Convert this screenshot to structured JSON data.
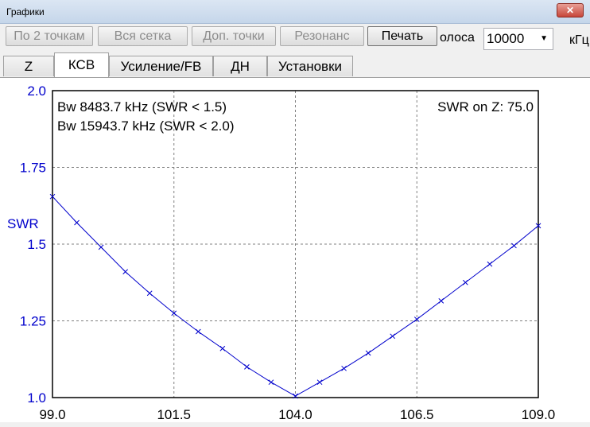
{
  "window": {
    "title": "Графики",
    "close_label": "✕"
  },
  "toolbar": {
    "buttons": [
      {
        "label": "По 2 точкам",
        "enabled": false
      },
      {
        "label": "Вся сетка",
        "enabled": false
      },
      {
        "label": "Доп. точки",
        "enabled": false
      },
      {
        "label": "Резонанс",
        "enabled": false
      },
      {
        "label": "Печать",
        "enabled": true
      }
    ],
    "band_label": "олоса",
    "band_value": "10000",
    "unit_label": "кГц"
  },
  "tabs": [
    {
      "label": "Z",
      "selected": false
    },
    {
      "label": "КСВ",
      "selected": true
    },
    {
      "label": "Усиление/FB",
      "selected": false
    },
    {
      "label": "ДН",
      "selected": false
    },
    {
      "label": "Установки",
      "selected": false
    }
  ],
  "chart_data": {
    "type": "line",
    "ylabel": "SWR",
    "xlabel": "",
    "xlim": [
      99.0,
      109.0
    ],
    "ylim": [
      1.0,
      2.0
    ],
    "x_ticks": [
      "99.0",
      "101.5",
      "104.0",
      "106.5",
      "109.0"
    ],
    "y_ticks": [
      "1.0",
      "1.25",
      "1.5",
      "1.75",
      "2.0"
    ],
    "grid": true,
    "annotations": [
      "Bw 8483.7 kHz (SWR < 1.5)",
      "Bw 15943.7 kHz (SWR < 2.0)",
      "SWR on Z: 75.0"
    ],
    "colors": {
      "line": "#0000cc",
      "axis_text": "#0000cc",
      "grid": "#808080"
    },
    "series": [
      {
        "x": [
          99.0,
          99.5,
          100.0,
          100.5,
          101.0,
          101.5,
          102.0,
          102.5,
          103.0,
          103.5,
          104.0,
          104.5,
          105.0,
          105.5,
          106.0,
          106.5,
          107.0,
          107.5,
          108.0,
          108.5,
          109.0
        ],
        "y": [
          1.655,
          1.57,
          1.49,
          1.41,
          1.34,
          1.275,
          1.215,
          1.16,
          1.1,
          1.05,
          1.005,
          1.05,
          1.095,
          1.145,
          1.2,
          1.255,
          1.315,
          1.375,
          1.435,
          1.495,
          1.56
        ]
      }
    ]
  }
}
